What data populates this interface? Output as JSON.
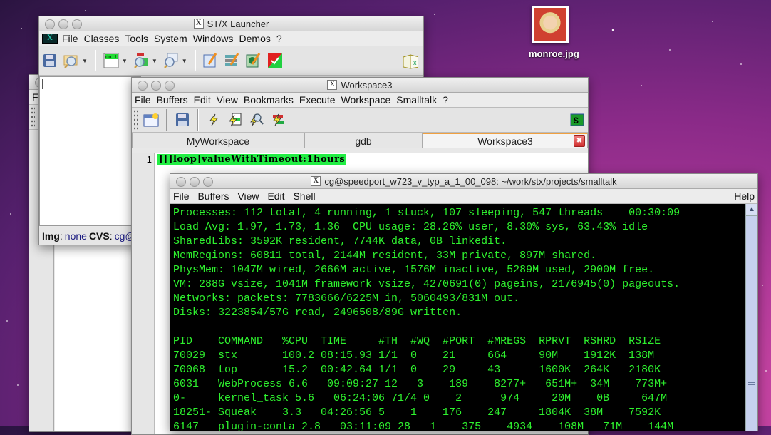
{
  "desktop": {
    "icon_label": "monroe.jpg"
  },
  "background_window": {
    "menu_first": "F"
  },
  "launcher": {
    "title": "ST/X Launcher",
    "menu": [
      "File",
      "Classes",
      "Tools",
      "System",
      "Windows",
      "Demos",
      "?"
    ],
    "toolbar_icons": [
      "save-icon",
      "open-browser-icon",
      "doit-icon",
      "inspect-icon",
      "search-icon",
      "edit-icon",
      "list-edit-icon",
      "tree-edit-icon",
      "test-runner-icon",
      "book-icon"
    ],
    "doit_label": "doit",
    "status": {
      "img_label": "Img",
      "img_value": "none",
      "cvs_label": "CVS",
      "cvs_value": "cg@"
    }
  },
  "workspace": {
    "title": "Workspace3",
    "menu": [
      "File",
      "Buffers",
      "Edit",
      "View",
      "Bookmarks",
      "Execute",
      "Workspace",
      "Smalltalk",
      "?"
    ],
    "tabs": [
      {
        "label": "MyWorkspace"
      },
      {
        "label": "gdb"
      },
      {
        "label": "Workspace3",
        "active": true
      }
    ],
    "line_number": "1",
    "code": "[[]loop]valueWithTimeout:1hours",
    "shell_icon": "$"
  },
  "terminal": {
    "title": "cg@speedport_w723_v_typ_a_1_00_098: ~/work/stx/projects/smalltalk",
    "menu": [
      "File",
      "Buffers",
      "View",
      "Edit",
      "Shell"
    ],
    "help": "Help",
    "summary": [
      "Processes: 112 total, 4 running, 1 stuck, 107 sleeping, 547 threads    00:30:09",
      "Load Avg: 1.97, 1.73, 1.36  CPU usage: 28.26% user, 8.30% sys, 63.43% idle",
      "SharedLibs: 3592K resident, 7744K data, 0B linkedit.",
      "MemRegions: 60811 total, 2144M resident, 33M private, 897M shared.",
      "PhysMem: 1047M wired, 2666M active, 1576M inactive, 5289M used, 2900M free.",
      "VM: 288G vsize, 1041M framework vsize, 4270691(0) pageins, 2176945(0) pageouts.",
      "Networks: packets: 7783666/6225M in, 5060493/831M out.",
      "Disks: 3223854/57G read, 2496508/89G written."
    ],
    "columns": [
      "PID",
      "COMMAND",
      "%CPU",
      "TIME",
      "#TH",
      "#WQ",
      "#PORT",
      "#MREGS",
      "RPRVT",
      "RSHRD",
      "RSIZE"
    ],
    "rows": [
      [
        "70029",
        "stx",
        "100.2",
        "08:15.93",
        "1/1",
        "0",
        "21",
        "664",
        "90M",
        "1912K",
        "138M"
      ],
      [
        "70068",
        "top",
        "15.2",
        "00:42.64",
        "1/1",
        "0",
        "29",
        "43",
        "1600K",
        "264K",
        "2180K"
      ],
      [
        "6031",
        "WebProcess",
        "6.6",
        "09:09:27",
        "12",
        "3",
        "189",
        "8277+",
        "651M+",
        "34M",
        "773M+"
      ],
      [
        "0-",
        "kernel_task",
        "5.6",
        "06:24:06",
        "71/4",
        "0",
        "2",
        "974",
        "20M",
        "0B",
        "647M"
      ],
      [
        "18251-",
        "Squeak",
        "3.3",
        "04:26:56",
        "5",
        "1",
        "176",
        "247",
        "1804K",
        "38M",
        "7592K"
      ],
      [
        "6147",
        "plugin-conta",
        "2.8",
        "03:11:09",
        "28",
        "1",
        "375",
        "4934",
        "108M",
        "71M",
        "144M"
      ]
    ]
  }
}
